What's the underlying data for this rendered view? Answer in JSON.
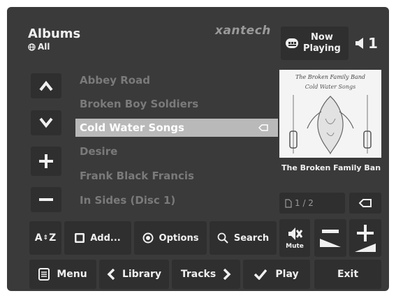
{
  "header": {
    "title": "Albums",
    "filter_label": "All",
    "brand": "xantech"
  },
  "now_playing": {
    "line1": "Now",
    "line2": "Playing"
  },
  "zone": {
    "number": "1"
  },
  "albums": [
    {
      "label": "Abbey Road",
      "selected": false
    },
    {
      "label": "Broken Boy Soldiers",
      "selected": false
    },
    {
      "label": "Cold Water Songs",
      "selected": true
    },
    {
      "label": "Desire",
      "selected": false
    },
    {
      "label": "Frank Black Francis",
      "selected": false
    },
    {
      "label": "In Sides (Disc 1)",
      "selected": false
    }
  ],
  "album_art": {
    "artist": "The Broken Family Ban",
    "cover_title": "The Broken Family Band",
    "cover_subtitle": "Cold Water Songs"
  },
  "pager": {
    "text": "1 / 2"
  },
  "toolbar": {
    "sort_label": "A",
    "sort_label2": "Z",
    "add_label": "Add...",
    "options_label": "Options",
    "search_label": "Search",
    "mute_label": "Mute"
  },
  "bottom": {
    "menu_label": "Menu",
    "library_label": "Library",
    "tracks_label": "Tracks",
    "play_label": "Play",
    "exit_label": "Exit"
  },
  "colors": {
    "panel": "#3a3a3a",
    "button": "#2f2f2f",
    "selected": "#b9b9b9",
    "text": "#f0f0f0",
    "muted_text": "#7a7a7a"
  },
  "icons": [
    "globe-icon",
    "now-playing-icon",
    "speaker-icon",
    "up-arrow-icon",
    "down-arrow-icon",
    "plus-icon",
    "minus-icon",
    "back-icon",
    "page-icon",
    "mute-icon",
    "volume-down-icon",
    "volume-up-icon",
    "stop-icon",
    "radio-icon",
    "search-icon",
    "menu-icon",
    "chevron-left-icon",
    "chevron-right-icon",
    "check-icon"
  ]
}
